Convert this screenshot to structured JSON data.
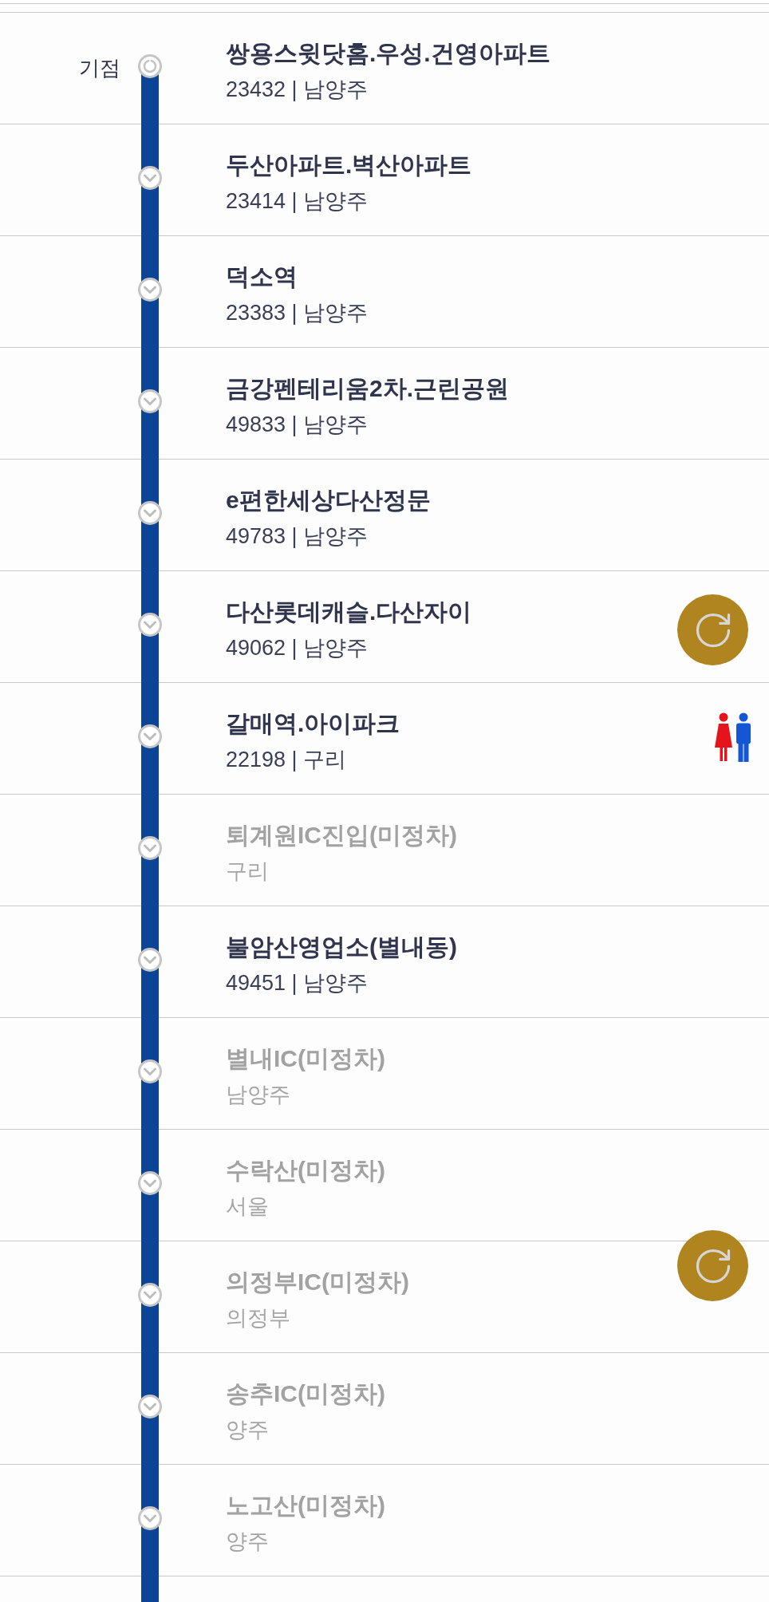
{
  "stations": [
    {
      "label": "기점",
      "kind": "origin",
      "name": "쌍용스윗닷홈.우성.건영아파트",
      "info": "23432 | 남양주",
      "stops": true,
      "restroom": false
    },
    {
      "kind": "stop",
      "name": "두산아파트.벽산아파트",
      "info": "23414 | 남양주",
      "stops": true,
      "restroom": false
    },
    {
      "kind": "stop",
      "name": "덕소역",
      "info": "23383 | 남양주",
      "stops": true,
      "restroom": false
    },
    {
      "kind": "stop",
      "name": "금강펜테리움2차.근린공원",
      "info": "49833 | 남양주",
      "stops": true,
      "restroom": false
    },
    {
      "kind": "stop",
      "name": "e편한세상다산정문",
      "info": "49783 | 남양주",
      "stops": true,
      "restroom": false
    },
    {
      "kind": "stop",
      "name": "다산롯데캐슬.다산자이",
      "info": "49062 | 남양주",
      "stops": true,
      "restroom": false
    },
    {
      "kind": "stop",
      "name": "갈매역.아이파크",
      "info": "22198 | 구리",
      "stops": true,
      "restroom": true
    },
    {
      "kind": "stop",
      "name": "퇴계원IC진입(미정차)",
      "info": "구리",
      "stops": false,
      "restroom": false
    },
    {
      "kind": "stop",
      "name": "불암산영업소(별내동)",
      "info": "49451 | 남양주",
      "stops": true,
      "restroom": false
    },
    {
      "kind": "stop",
      "name": "별내IC(미정차)",
      "info": "남양주",
      "stops": false,
      "restroom": false
    },
    {
      "kind": "stop",
      "name": "수락산(미정차)",
      "info": "서울",
      "stops": false,
      "restroom": false
    },
    {
      "kind": "stop",
      "name": "의정부IC(미정차)",
      "info": "의정부",
      "stops": false,
      "restroom": false
    },
    {
      "kind": "stop",
      "name": "송추IC(미정차)",
      "info": "양주",
      "stops": false,
      "restroom": false
    },
    {
      "kind": "stop",
      "name": "노고산(미정차)",
      "info": "양주",
      "stops": false,
      "restroom": false
    }
  ]
}
